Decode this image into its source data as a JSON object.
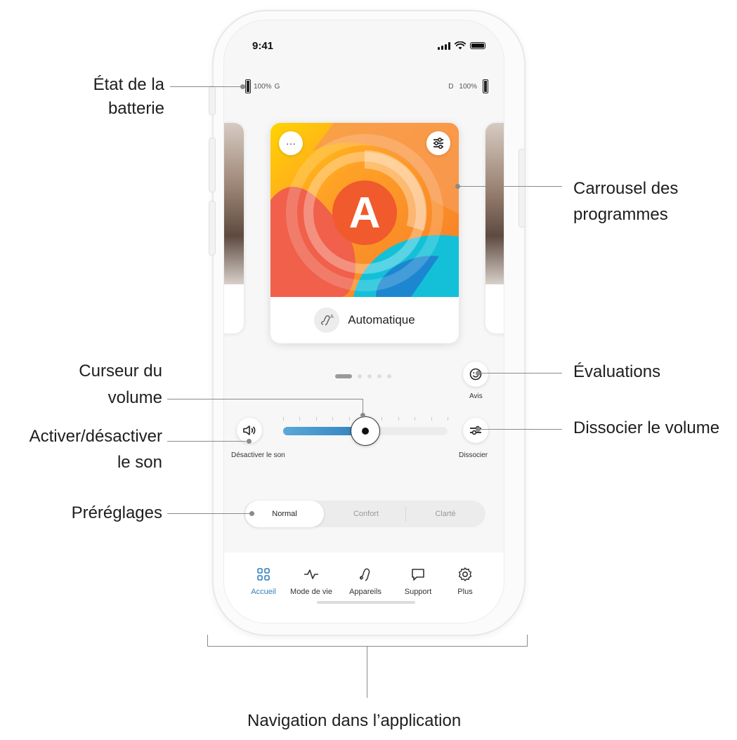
{
  "status_bar": {
    "time": "9:41"
  },
  "hearing_batteries": {
    "left": {
      "percent": "100%",
      "side": "G"
    },
    "right": {
      "percent": "100%",
      "side": "D"
    }
  },
  "program_card": {
    "letter": "A",
    "name": "Automatique",
    "more_icon": "ellipsis-icon",
    "settings_icon": "sliders-icon",
    "program_icon_text": "A"
  },
  "carousel": {
    "pages": 5,
    "active_page": 1
  },
  "volume": {
    "mute_label": "Désactiver le son",
    "level": 0.5,
    "feedback_label": "Avis",
    "split_label": "Dissocier"
  },
  "presets": {
    "options": [
      "Normal",
      "Confort",
      "Clarté"
    ],
    "selected": "Normal"
  },
  "tabbar": {
    "items": [
      {
        "label": "Accueil",
        "icon": "grid-icon",
        "active": true
      },
      {
        "label": "Mode de vie",
        "icon": "activity-icon",
        "active": false
      },
      {
        "label": "Appareils",
        "icon": "hearing-aid-icon",
        "active": false
      },
      {
        "label": "Support",
        "icon": "chat-icon",
        "active": false
      },
      {
        "label": "Plus",
        "icon": "gear-icon",
        "active": false
      }
    ]
  },
  "annotations": {
    "battery_1": "État de la",
    "battery_2": "batterie",
    "carousel_1": "Carrousel des",
    "carousel_2": "programmes",
    "cursor_1": "Curseur du",
    "cursor_2": "volume",
    "mute_1": "Activer/désactiver",
    "mute_2": "le son",
    "feedback": "Évaluations",
    "split": "Dissocier le volume",
    "presets": "Préréglages",
    "navigation": "Navigation dans l’application"
  },
  "colors": {
    "accent": "#2f7fbf",
    "slider_start": "#5aa9d8"
  }
}
